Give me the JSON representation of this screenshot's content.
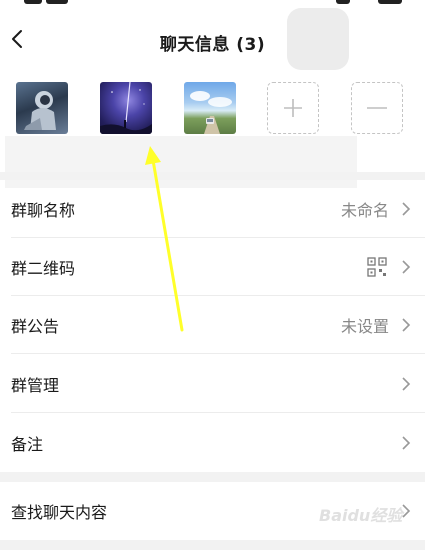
{
  "header": {
    "title": "聊天信息 (3)",
    "back_icon": "chevron-left-icon"
  },
  "members": [
    {
      "name": "member-avatar-1"
    },
    {
      "name": "member-avatar-2"
    },
    {
      "name": "member-avatar-3"
    }
  ],
  "actions": {
    "add_icon": "plus-icon",
    "remove_icon": "minus-icon"
  },
  "settings": [
    {
      "label": "群聊名称",
      "value": "未命名"
    },
    {
      "label": "群二维码",
      "value": "",
      "icon": "qr-code-icon"
    },
    {
      "label": "群公告",
      "value": "未设置"
    },
    {
      "label": "群管理",
      "value": ""
    },
    {
      "label": "备注",
      "value": ""
    }
  ],
  "search_row": {
    "label": "查找聊天内容"
  },
  "annotation": {
    "color": "#ffff2a"
  },
  "watermark": {
    "text": "Baidu经验",
    "color": "#c8c8c8"
  }
}
